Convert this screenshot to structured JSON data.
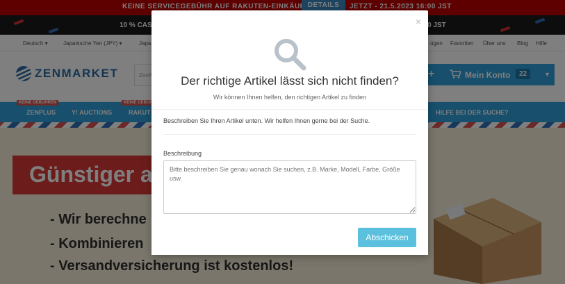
{
  "promo": {
    "left": "KEINE SERVICEGEBÜHR AUF RAKUTEN-EINKÄUFE",
    "details_button": "DETAILS",
    "right": "JETZT - 21.5.2023 16:00 JST",
    "cashback_left": "10 % CAS",
    "cashback_right": "0 JST"
  },
  "topbar": {
    "language": "Deutsch ▾",
    "currency": "Japanische Yen (JPY) ▾",
    "japan": "Japa",
    "links": [
      "ügen",
      "Favoriten",
      "Über uns",
      "Blog",
      "Hilfe"
    ]
  },
  "header": {
    "logo_text": "ZENMARKET",
    "search_placeholder": "ZenP",
    "account_label": "Mein Konto",
    "account_badge": "22"
  },
  "nav": {
    "items": [
      "ZENPLUS",
      "Y! AUCTIONS",
      "RAKUT",
      "HILFE BEI DER SUCHE?"
    ],
    "badge": "KEINE GEBÜHREN"
  },
  "hero": {
    "banner": "Günstiger a",
    "bullets": [
      "- Wir berechne",
      "- Kombinieren",
      "- Versandversicherung ist kostenlos!"
    ]
  },
  "modal": {
    "close": "×",
    "title": "Der richtige Artikel lässt sich nicht finden?",
    "subtitle": "Wir können Ihnen helfen, den richtigen Artikel zu finden",
    "intro": "Beschreiben Sie Ihren Artikel unten. Wir helfen Ihnen gerne bei der Suche.",
    "label": "Beschreibung",
    "placeholder": "Bitte beschreiben Sie genau wonach Sie suchen, z.B. Marke, Modell, Farbe, Größe usw.",
    "submit": "Abschicken"
  },
  "colors": {
    "promo_red": "#bf0000",
    "brand_blue": "#2e9ed8",
    "banner_red": "#d83a36",
    "submit_blue": "#5bc0de"
  }
}
